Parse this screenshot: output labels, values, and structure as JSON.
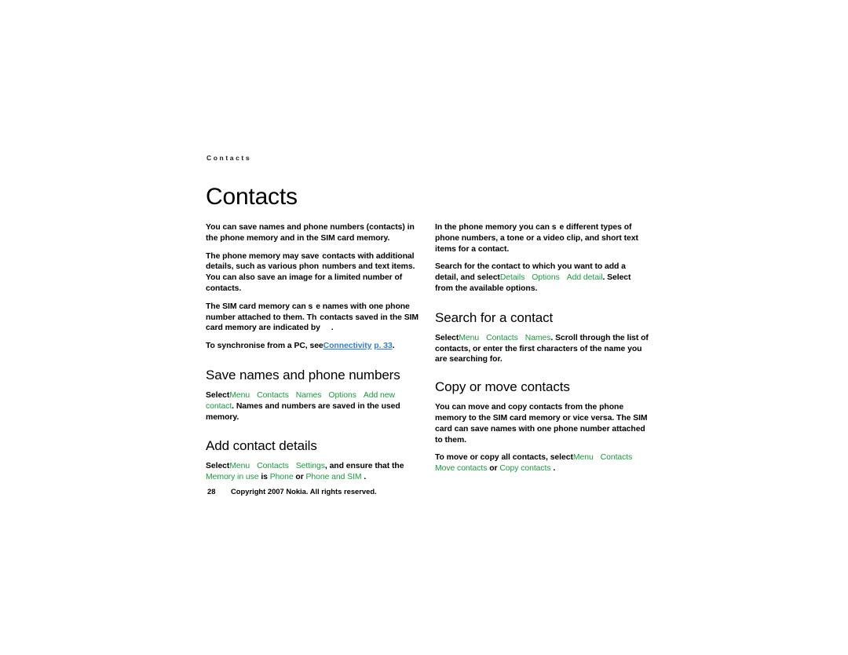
{
  "page": {
    "running_head": "Contacts",
    "chapter_title": "Contacts",
    "page_number": "28",
    "copyright": "Copyright  2007 Nokia. All rights reserved."
  },
  "colors": {
    "menu_green": "#17993a",
    "link_blue": "#2e7fd0",
    "text_black": "#000000",
    "page_background": "#ffffff"
  },
  "left_column": {
    "intro": {
      "p1": "You can save names and phone numbers (contacts) in the phone memory and in the SIM card memory.",
      "p2_a": "The phone memory may save",
      "p2_b": "contacts with additional details, such as various phon",
      "p2_c": "numbers and text items. You can also save an image for a limited number of contacts.",
      "p3_a": "The SIM card memory can s",
      "p3_b": "e names with one phone number attached to them. Th",
      "p3_c": "contacts saved in the SIM card memory are indicated by",
      "p3_d": "."
    },
    "sync": {
      "prefix": "To synchronise from a PC, see",
      "link_text": "Connectivity",
      "link_page": "p. 33",
      "suffix": "."
    },
    "save_names": {
      "heading": "Save names and phone numbers",
      "select_label": "Select",
      "path": [
        "Menu",
        "Contacts",
        "Names",
        "Options",
        "Add new contact"
      ],
      "tail": ". Names and numbers are saved in the used memory."
    },
    "add_contact_details": {
      "heading": "Add contact details",
      "select_label": "Select",
      "path": [
        "Menu",
        "Contacts",
        "Settings"
      ],
      "mid": ", and ensure that the",
      "setting_name": "Memory in use",
      "is_label": "is",
      "option_1": "Phone",
      "or_label": "or",
      "option_2": "Phone and SIM",
      "tail": "."
    }
  },
  "right_column": {
    "phone_memory": {
      "p1_a": "In the phone memory you can s",
      "p1_b": "e different types of phone numbers, a tone or a video clip, and short text items for a contact.",
      "p2_a": "Search for the contact to which you want to add a detail, and select",
      "p2_path": [
        "Details",
        "Options",
        "Add detail"
      ],
      "p2_tail": ". Select from the available options."
    },
    "search_contact": {
      "heading": "Search for a contact",
      "select_label": "Select",
      "path": [
        "Menu",
        "Contacts",
        "Names"
      ],
      "tail": ". Scroll through the list of contacts, or enter the first characters of the name you are searching for."
    },
    "copy_move": {
      "heading": "Copy or move contacts",
      "p1": "You can move and copy contacts from the phone memory to the SIM card memory or vice versa. The SIM card can save names with one phone number attached to them.",
      "p2_prefix": "To move or copy all contacts, select",
      "p2_path": [
        "Menu",
        "Contacts"
      ],
      "option_1": "Move contacts",
      "or_label": "or",
      "option_2": "Copy contacts",
      "tail": "."
    }
  }
}
